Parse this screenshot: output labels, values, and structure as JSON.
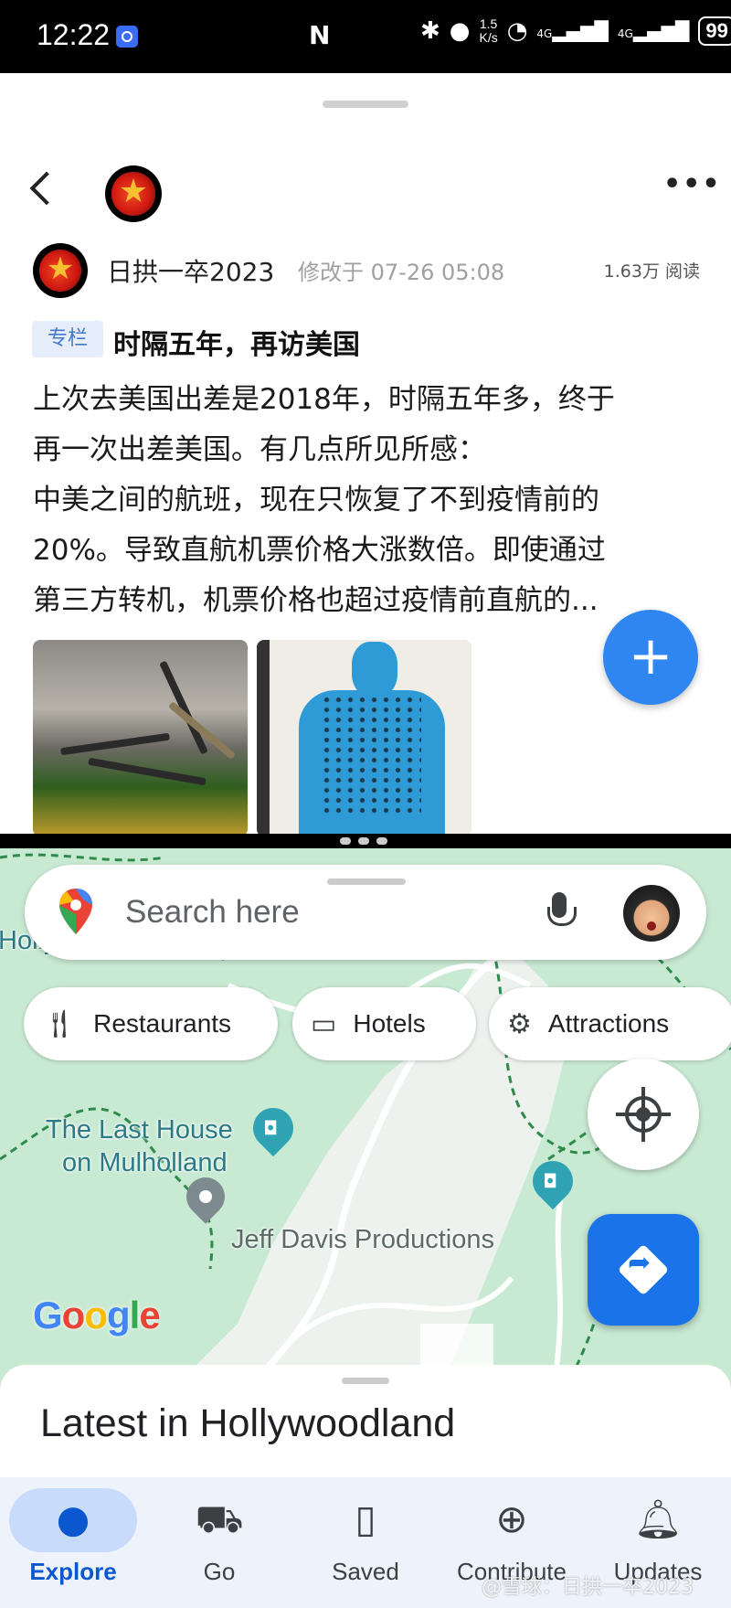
{
  "status_bar": {
    "time": "12:22",
    "nfc": "N",
    "speed_top": "1.5",
    "speed_bottom": "K/s",
    "net1": "4G",
    "net2": "4G",
    "battery": "99"
  },
  "post": {
    "author": "日拱一卒2023",
    "edited": "修改于 07-26 05:08",
    "views": "1.63万 阅读",
    "tag": "专栏",
    "title": "时隔五年，再访美国",
    "body_lines": [
      "上次去美国出差是2018年，时隔五年多，终于",
      "再一次出差美国。有几点所见所感：",
      "中美之间的航班，现在只恢复了不到疫情前的",
      "20%。导致直航机票价格大涨数倍。即使通过",
      "第三方转机，机票价格也超过疫情前直航的..."
    ],
    "fab_label": "+"
  },
  "maps": {
    "search_placeholder": "Search here",
    "chips": [
      {
        "label": "Restaurants",
        "icon": "restaurant-icon"
      },
      {
        "label": "Hotels",
        "icon": "hotel-icon"
      },
      {
        "label": "Attractions",
        "icon": "attractions-icon"
      }
    ],
    "places": [
      {
        "label": "Hollywood Sign"
      },
      {
        "label": "The Last House"
      },
      {
        "label": "on Mulholland"
      },
      {
        "label": "Jeff Davis Productions"
      }
    ],
    "logo": "Google",
    "sheet_title": "Latest in Hollywoodland",
    "nav": [
      {
        "label": "Explore",
        "icon": "explore-pin-icon",
        "active": true
      },
      {
        "label": "Go",
        "icon": "commute-icon",
        "active": false
      },
      {
        "label": "Saved",
        "icon": "bookmark-icon",
        "active": false
      },
      {
        "label": "Contribute",
        "icon": "add-circle-icon",
        "active": false
      },
      {
        "label": "Updates",
        "icon": "bell-icon",
        "active": false
      }
    ],
    "colors": {
      "accent": "#1a73e8",
      "map_green": "#c8e9d2",
      "poi_teal": "#2fa3b3"
    }
  },
  "watermark": "@雪球：日拱一卒2023"
}
